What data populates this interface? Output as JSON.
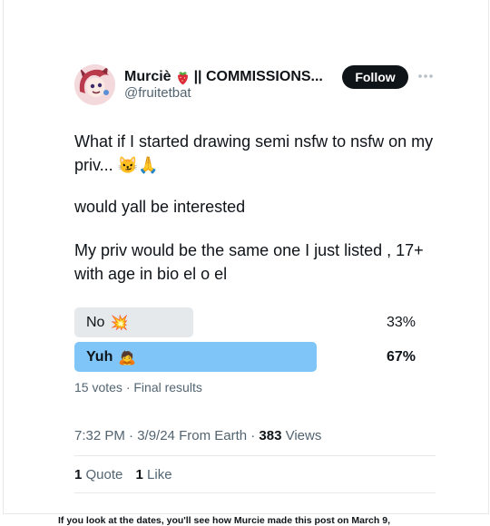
{
  "author": {
    "name": "Murciè",
    "name_suffix": "|| COMMISSIONS...",
    "handle": "@fruitetbat",
    "follow_label": "Follow"
  },
  "tweet": {
    "line1": "What if I started drawing semi nsfw to nsfw on my",
    "line2": "priv... 😼🙏",
    "para2": "would yall be interested",
    "para3_line1": "My priv would be the same one I just listed , 17+",
    "para3_line2": "with age in bio el o el"
  },
  "poll": {
    "options": [
      {
        "label": "No",
        "emoji": "💥",
        "percent": "33%",
        "value": 33,
        "winner": false
      },
      {
        "label": "Yuh",
        "emoji": "🙇",
        "percent": "67%",
        "value": 67,
        "winner": true
      }
    ],
    "summary": "15 votes · Final results"
  },
  "meta": {
    "time": "7:32 PM · 3/9/24 From Earth · ",
    "views_count": "383",
    "views_label": " Views"
  },
  "stats": {
    "quotes_count": "1",
    "quotes_label": " Quote",
    "likes_count": "1",
    "likes_label": " Like"
  },
  "caption": "If you look at the dates, you'll see how Murcie made this post on March 9,",
  "colors": {
    "winner_bar": "#7fc5f7",
    "loser_bar": "#e6e9ec",
    "secondary_text": "#536471",
    "follow_bg": "#0f1419"
  }
}
